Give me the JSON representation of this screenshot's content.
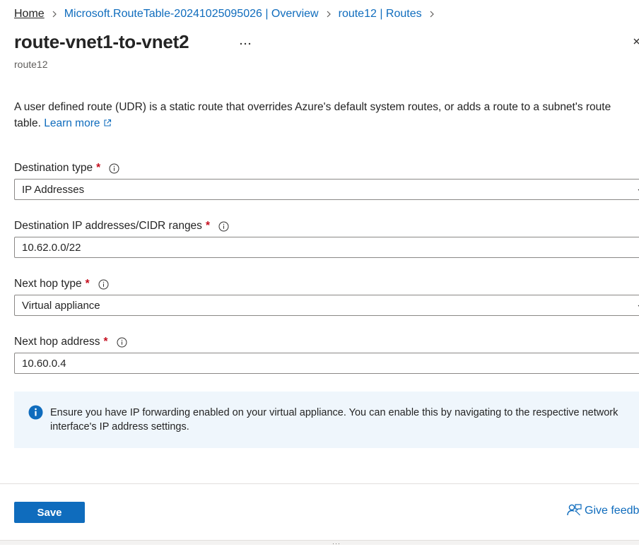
{
  "breadcrumb": {
    "items": [
      "Home",
      "Microsoft.RouteTable-20241025095026 | Overview",
      "route12 | Routes"
    ]
  },
  "header": {
    "title": "route-vnet1-to-vnet2",
    "subtitle": "route12",
    "more_label": "···"
  },
  "description": {
    "line1": "A user defined route (UDR) is a static route that overrides Azure's default system routes, or adds a route to a subnet's route",
    "line2": "table.",
    "link": "Learn more"
  },
  "form": {
    "destination_type": {
      "label": "Destination type",
      "required": "*",
      "value": "IP Addresses"
    },
    "destination_ip": {
      "label": "Destination IP addresses/CIDR ranges",
      "required": "*",
      "value": "10.62.0.0/22"
    },
    "next_hop_type": {
      "label": "Next hop type",
      "required": "*",
      "value": "Virtual appliance"
    },
    "next_hop_address": {
      "label": "Next hop address",
      "required": "*",
      "value": "10.60.0.4"
    }
  },
  "notice": {
    "text": "Ensure you have IP forwarding enabled on your virtual appliance. You can enable this by navigating to the respective network interface's IP address settings."
  },
  "footer": {
    "save_label": "Save",
    "feedback_label": "Give feedback",
    "grip_label": "···"
  },
  "colors": {
    "accent": "#0f6cbd",
    "required": "#c50f1f",
    "notice_bg": "#eff6fc"
  },
  "icons": [
    "chevron-right-icon",
    "more-icon",
    "close-icon",
    "external-link-icon",
    "info-icon",
    "chevron-down-icon",
    "info-filled-icon",
    "feedback-icon"
  ]
}
